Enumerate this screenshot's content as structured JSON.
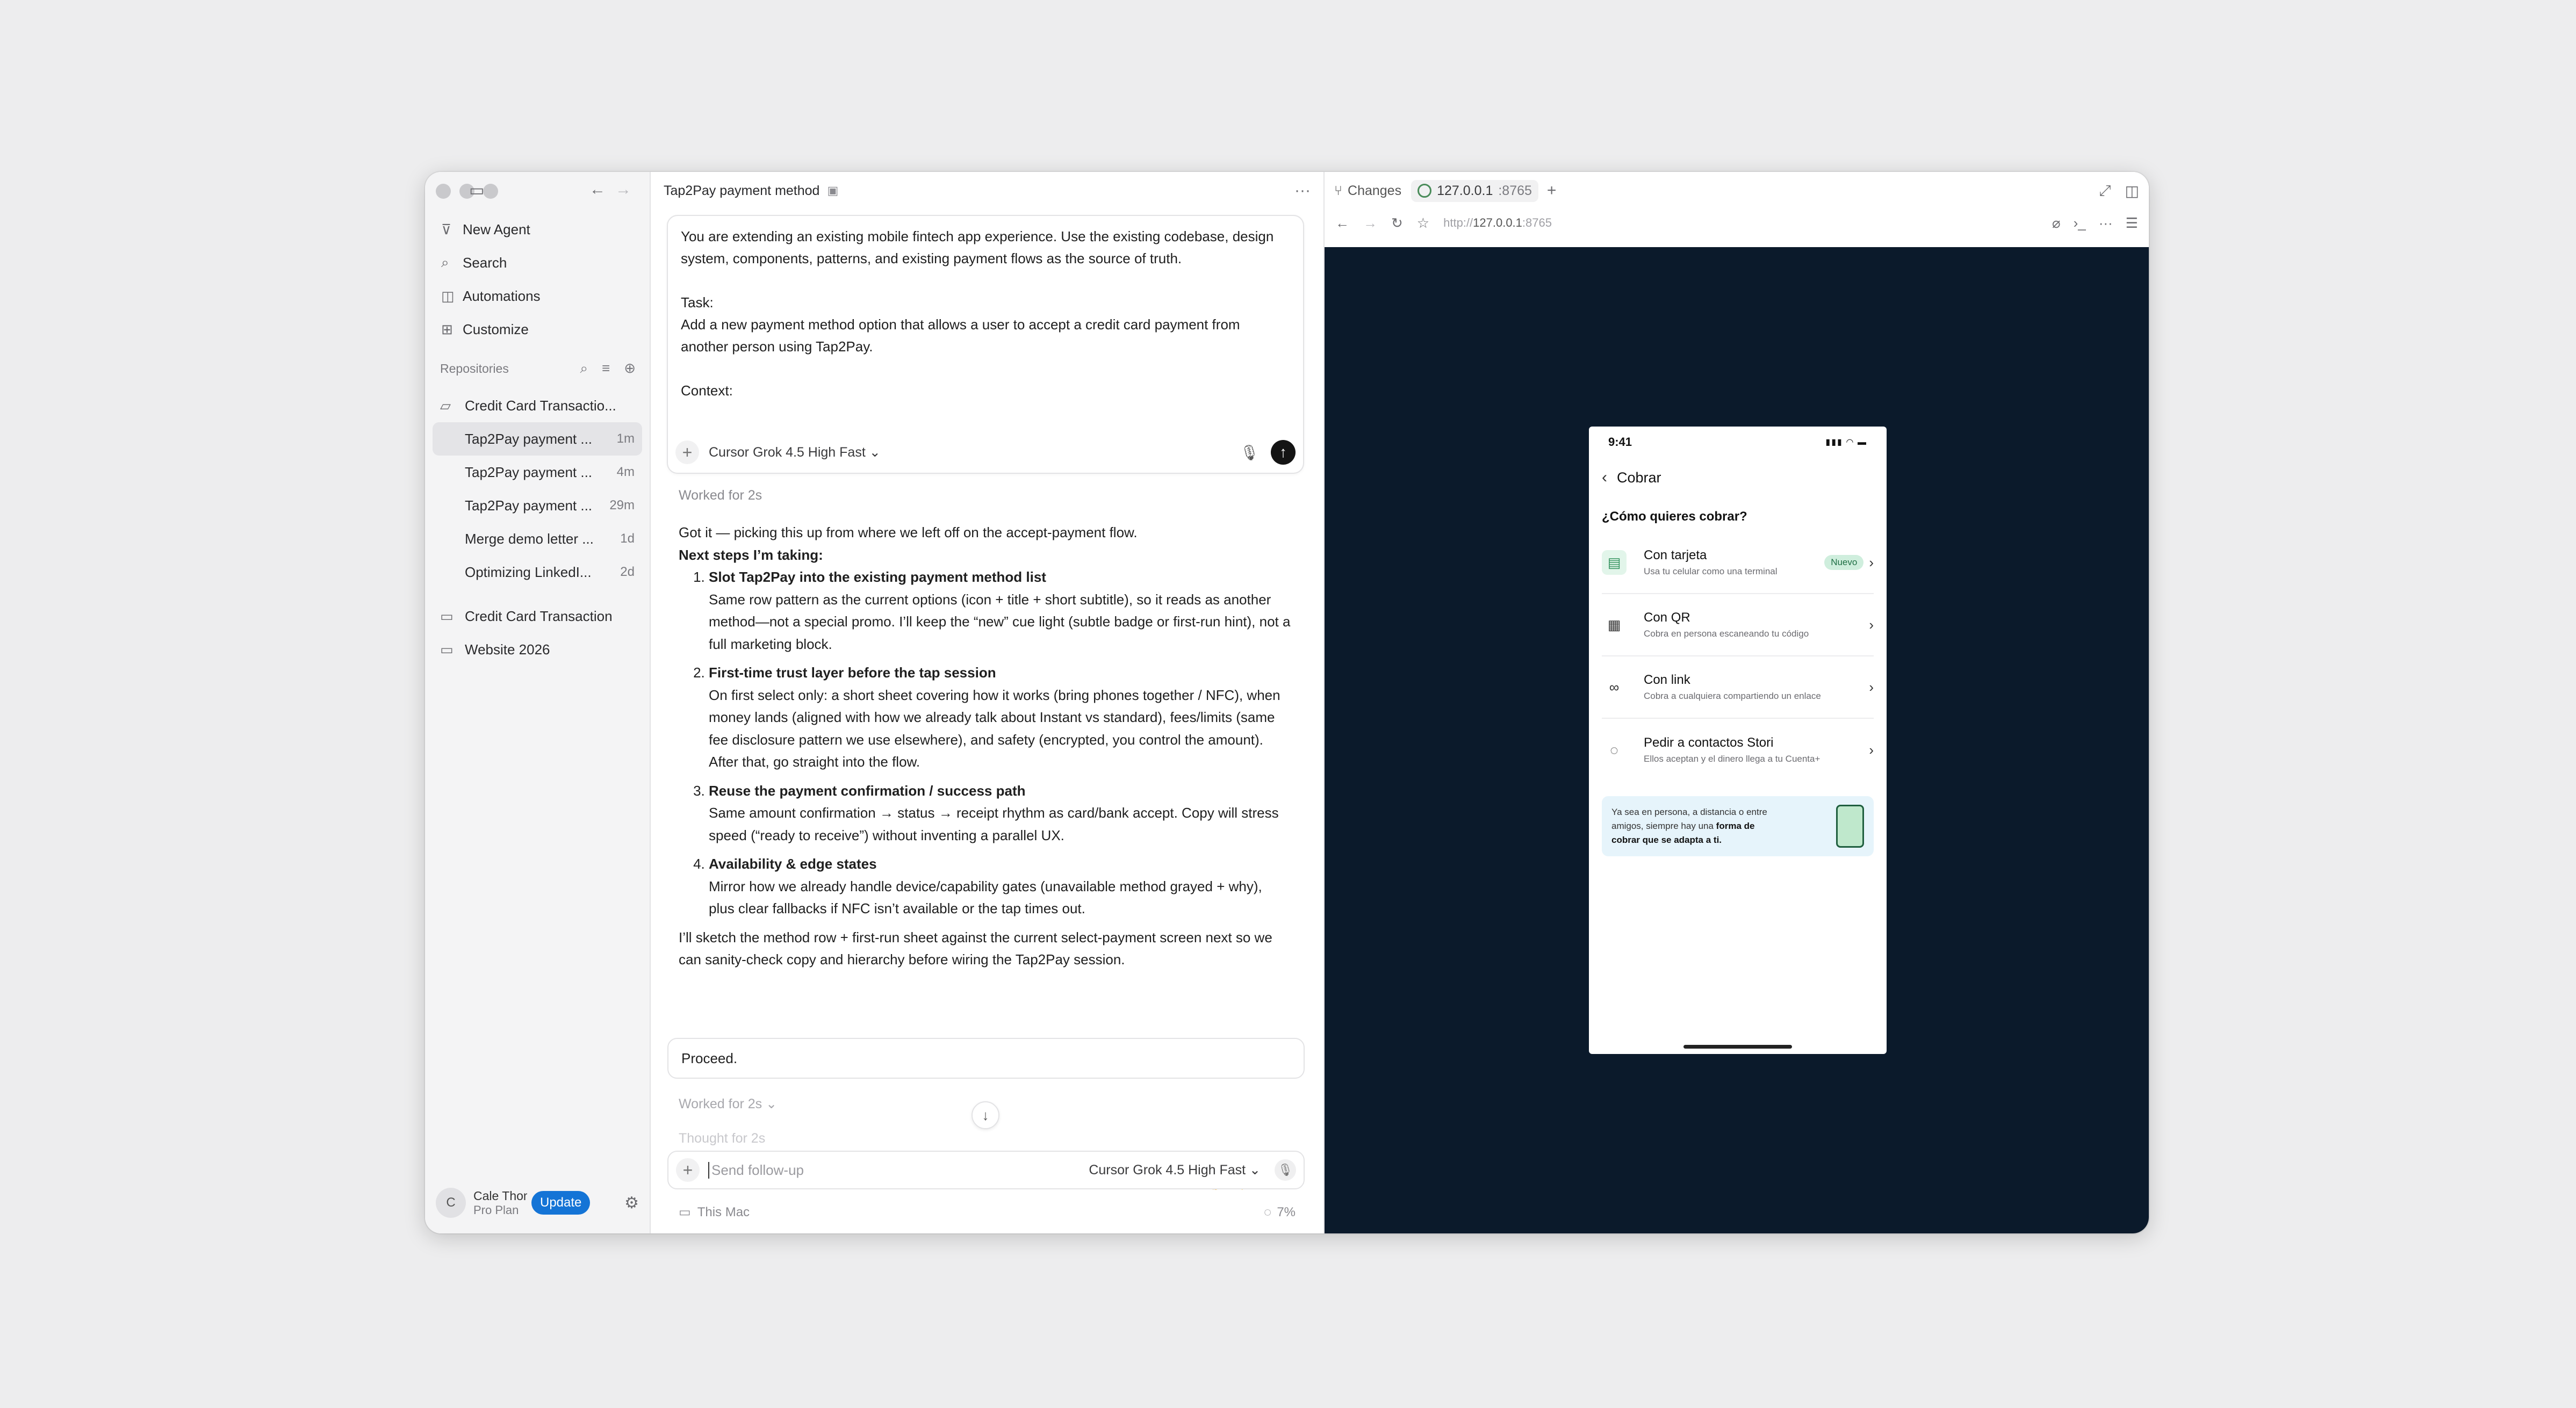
{
  "sidebar": {
    "nav": [
      {
        "label": "New Agent",
        "icon": "new-agent-icon"
      },
      {
        "label": "Search",
        "icon": "search-icon"
      },
      {
        "label": "Automations",
        "icon": "automations-icon"
      },
      {
        "label": "Customize",
        "icon": "customize-icon"
      }
    ],
    "repositories_label": "Repositories",
    "repo1": {
      "name": "Credit Card Transactio...",
      "chats": [
        {
          "title": "Tap2Pay payment ...",
          "time": "1m"
        },
        {
          "title": "Tap2Pay payment ...",
          "time": "4m"
        },
        {
          "title": "Tap2Pay payment ...",
          "time": "29m"
        },
        {
          "title": "Merge demo letter ...",
          "time": "1d"
        },
        {
          "title": "Optimizing LinkedI...",
          "time": "2d"
        }
      ]
    },
    "repo2": "Credit Card Transaction",
    "repo3": "Website 2026",
    "user": {
      "initial": "C",
      "name": "Cale Thompson",
      "plan": "Pro Plan",
      "update": "Update"
    }
  },
  "chat": {
    "title": "Tap2Pay payment method",
    "prompt": "You are extending an existing mobile fintech app experience. Use the existing codebase, design system, components, patterns, and existing payment flows as the source of truth.\n\nTask:\nAdd a new payment method option that allows a user to accept a credit card payment from another person using Tap2Pay.\n\nContext:",
    "model": "Cursor Grok 4.5 High Fast ⌄",
    "worked1": "Worked for 2s",
    "intro": "Got it — picking this up from where we left off on the accept-payment flow.",
    "next_steps": "Next steps I’m taking:",
    "steps": [
      {
        "title": "Slot Tap2Pay into the existing payment method list",
        "body": "Same row pattern as the current options (icon + title + short subtitle), so it reads as another method—not a special promo. I’ll keep the “new” cue light (subtle badge or first-run hint), not a full marketing block."
      },
      {
        "title": "First-time trust layer before the tap session",
        "body": "On first select only: a short sheet covering how it works (bring phones together / NFC), when money lands (aligned with how we already talk about Instant vs standard), fees/limits (same fee disclosure pattern we use elsewhere), and safety (encrypted, you control the amount). After that, go straight into the flow."
      },
      {
        "title": "Reuse the payment confirmation / success path",
        "body": "Same amount confirmation → status → receipt rhythm as card/bank accept. Copy will stress speed (“ready to receive”) without inventing a parallel UX."
      },
      {
        "title": "Availability & edge states",
        "body": "Mirror how we already handle device/capability gates (unavailable method grayed + why), plus clear fallbacks if NFC isn’t available or the tap times out."
      }
    ],
    "outro": "I’ll sketch the method row + first-run sheet against the current select-payment screen next so we can sanity-check copy and hierarchy before wiring the Tap2Pay session.",
    "user_reply": "Proceed.",
    "worked2": "Worked for 2s ⌄",
    "thought": "Thought for 2s",
    "followup_placeholder": "Send follow-up",
    "location": "This Mac",
    "context_pct": "7%"
  },
  "browser": {
    "changes": "Changes",
    "tab_host": "127.0.0.1",
    "tab_port": ":8765",
    "url_prefix": "http://",
    "url_host": "127.0.0.1",
    "url_port": ":8765"
  },
  "phone": {
    "time": "9:41",
    "header": "Cobrar",
    "question": "¿Cómo quieres cobrar?",
    "options": [
      {
        "title": "Con tarjeta",
        "subtitle": "Usa tu celular como una terminal",
        "badge": "Nuevo",
        "icon": "card-terminal-icon"
      },
      {
        "title": "Con QR",
        "subtitle": "Cobra en persona escaneando tu código",
        "icon": "qr-icon"
      },
      {
        "title": "Con link",
        "subtitle": "Cobra a cualquiera compartiendo un enlace",
        "icon": "link-icon"
      },
      {
        "title": "Pedir a contactos Stori",
        "subtitle": "Ellos aceptan y el dinero llega a tu Cuenta+",
        "icon": "chat-icon"
      }
    ],
    "promo_text": "Ya sea en persona, a distancia o entre amigos, siempre hay una",
    "promo_bold": "forma de cobrar que se adapta a ti."
  },
  "colors": {
    "accent": "#1474d6",
    "viewport_bg": "#0b1a2b",
    "badge_bg": "#cfeedd",
    "promo_bg": "#e6f4fb"
  }
}
